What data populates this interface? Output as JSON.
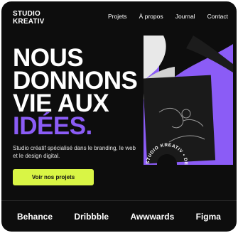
{
  "brand": {
    "logo": "STUDIO\nKREATIV"
  },
  "nav": {
    "items": [
      "Projets",
      "À propos",
      "Journal",
      "Contact"
    ]
  },
  "hero": {
    "lines": [
      "NOUS",
      "DONNONS",
      "VIE AUX"
    ],
    "accent": "IDÉES.",
    "description": "Studio créatif spécialisé dans le branding, le web et le design digital.",
    "cta": "Voir nos projets",
    "badge_text": "STUDIO KREATIV • DESIGN • "
  },
  "clients": [
    "Behance",
    "Dribbble",
    "Awwwards",
    "Figma"
  ],
  "colors": {
    "background": "#0d0d0d",
    "accent": "#8b5cf6",
    "cta": "#d9f545"
  }
}
